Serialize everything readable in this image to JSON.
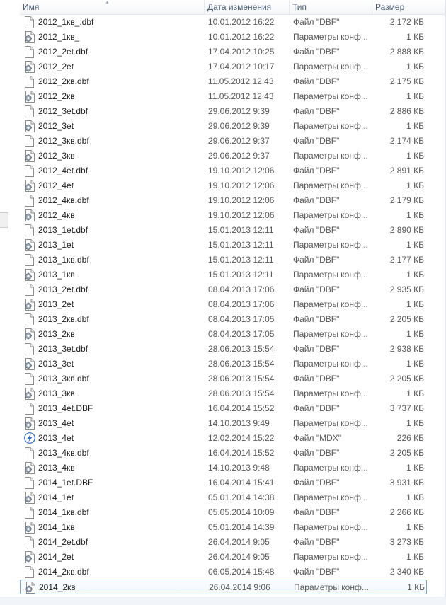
{
  "columns": {
    "name": "Имя",
    "date": "Дата изменения",
    "type": "Тип",
    "size": "Размер"
  },
  "icon_names": {
    "doc": "document-icon",
    "cfg": "settings-file-icon",
    "mdx": "lightning-icon"
  },
  "colors": {
    "selection_border": "#7da2ce",
    "header_text": "#4c607a"
  },
  "files": [
    {
      "name": "2012_1кв_.dbf",
      "date": "10.01.2012 16:22",
      "type": "Файл \"DBF\"",
      "size": "2 172 КБ",
      "icon": "doc"
    },
    {
      "name": "2012_1кв_",
      "date": "10.01.2012 16:22",
      "type": "Параметры конф...",
      "size": "1 КБ",
      "icon": "cfg"
    },
    {
      "name": "2012_2et.dbf",
      "date": "17.04.2012 10:25",
      "type": "Файл \"DBF\"",
      "size": "2 888 КБ",
      "icon": "doc"
    },
    {
      "name": "2012_2et",
      "date": "17.04.2012 10:17",
      "type": "Параметры конф...",
      "size": "1 КБ",
      "icon": "cfg"
    },
    {
      "name": "2012_2кв.dbf",
      "date": "11.05.2012 12:43",
      "type": "Файл \"DBF\"",
      "size": "2 175 КБ",
      "icon": "doc"
    },
    {
      "name": "2012_2кв",
      "date": "11.05.2012 12:43",
      "type": "Параметры конф...",
      "size": "1 КБ",
      "icon": "cfg"
    },
    {
      "name": "2012_3et.dbf",
      "date": "29.06.2012 9:39",
      "type": "Файл \"DBF\"",
      "size": "2 886 КБ",
      "icon": "doc"
    },
    {
      "name": "2012_3et",
      "date": "29.06.2012 9:39",
      "type": "Параметры конф...",
      "size": "1 КБ",
      "icon": "cfg"
    },
    {
      "name": "2012_3кв.dbf",
      "date": "29.06.2012 9:37",
      "type": "Файл \"DBF\"",
      "size": "2 174 КБ",
      "icon": "doc"
    },
    {
      "name": "2012_3кв",
      "date": "29.06.2012 9:37",
      "type": "Параметры конф...",
      "size": "1 КБ",
      "icon": "cfg"
    },
    {
      "name": "2012_4et.dbf",
      "date": "19.10.2012 12:06",
      "type": "Файл \"DBF\"",
      "size": "2 891 КБ",
      "icon": "doc"
    },
    {
      "name": "2012_4et",
      "date": "19.10.2012 12:06",
      "type": "Параметры конф...",
      "size": "1 КБ",
      "icon": "cfg"
    },
    {
      "name": "2012_4кв.dbf",
      "date": "19.10.2012 12:06",
      "type": "Файл \"DBF\"",
      "size": "2 179 КБ",
      "icon": "doc"
    },
    {
      "name": "2012_4кв",
      "date": "19.10.2012 12:06",
      "type": "Параметры конф...",
      "size": "1 КБ",
      "icon": "cfg"
    },
    {
      "name": "2013_1et.dbf",
      "date": "15.01.2013 12:11",
      "type": "Файл \"DBF\"",
      "size": "2 890 КБ",
      "icon": "doc"
    },
    {
      "name": "2013_1et",
      "date": "15.01.2013 12:11",
      "type": "Параметры конф...",
      "size": "1 КБ",
      "icon": "cfg"
    },
    {
      "name": "2013_1кв.dbf",
      "date": "15.01.2013 12:11",
      "type": "Файл \"DBF\"",
      "size": "2 177 КБ",
      "icon": "doc"
    },
    {
      "name": "2013_1кв",
      "date": "15.01.2013 12:11",
      "type": "Параметры конф...",
      "size": "1 КБ",
      "icon": "cfg"
    },
    {
      "name": "2013_2et.dbf",
      "date": "08.04.2013 17:06",
      "type": "Файл \"DBF\"",
      "size": "2 935 КБ",
      "icon": "doc"
    },
    {
      "name": "2013_2et",
      "date": "08.04.2013 17:06",
      "type": "Параметры конф...",
      "size": "1 КБ",
      "icon": "cfg"
    },
    {
      "name": "2013_2кв.dbf",
      "date": "08.04.2013 17:05",
      "type": "Файл \"DBF\"",
      "size": "2 205 КБ",
      "icon": "doc"
    },
    {
      "name": "2013_2кв",
      "date": "08.04.2013 17:05",
      "type": "Параметры конф...",
      "size": "1 КБ",
      "icon": "cfg"
    },
    {
      "name": "2013_3et.dbf",
      "date": "28.06.2013 15:54",
      "type": "Файл \"DBF\"",
      "size": "2 938 КБ",
      "icon": "doc"
    },
    {
      "name": "2013_3et",
      "date": "28.06.2013 15:54",
      "type": "Параметры конф...",
      "size": "1 КБ",
      "icon": "cfg"
    },
    {
      "name": "2013_3кв.dbf",
      "date": "28.06.2013 15:54",
      "type": "Файл \"DBF\"",
      "size": "2 205 КБ",
      "icon": "doc"
    },
    {
      "name": "2013_3кв",
      "date": "28.06.2013 15:54",
      "type": "Параметры конф...",
      "size": "1 КБ",
      "icon": "cfg"
    },
    {
      "name": "2013_4et.DBF",
      "date": "16.04.2014 15:52",
      "type": "Файл \"DBF\"",
      "size": "3 737 КБ",
      "icon": "doc"
    },
    {
      "name": "2013_4et",
      "date": "14.10.2013 9:49",
      "type": "Параметры конф...",
      "size": "1 КБ",
      "icon": "cfg"
    },
    {
      "name": "2013_4et",
      "date": "12.02.2014 15:22",
      "type": "Файл \"MDX\"",
      "size": "226 КБ",
      "icon": "mdx"
    },
    {
      "name": "2013_4кв.dbf",
      "date": "16.04.2014 15:52",
      "type": "Файл \"DBF\"",
      "size": "2 205 КБ",
      "icon": "doc"
    },
    {
      "name": "2013_4кв",
      "date": "14.10.2013 9:48",
      "type": "Параметры конф...",
      "size": "1 КБ",
      "icon": "cfg"
    },
    {
      "name": "2014_1et.DBF",
      "date": "16.04.2014 15:41",
      "type": "Файл \"DBF\"",
      "size": "3 931 КБ",
      "icon": "doc"
    },
    {
      "name": "2014_1et",
      "date": "05.01.2014 14:38",
      "type": "Параметры конф...",
      "size": "1 КБ",
      "icon": "cfg"
    },
    {
      "name": "2014_1кв.dbf",
      "date": "05.05.2014 10:09",
      "type": "Файл \"DBF\"",
      "size": "2 266 КБ",
      "icon": "doc"
    },
    {
      "name": "2014_1кв",
      "date": "05.01.2014 14:39",
      "type": "Параметры конф...",
      "size": "1 КБ",
      "icon": "cfg"
    },
    {
      "name": "2014_2et.dbf",
      "date": "26.04.2014 9:05",
      "type": "Файл \"DBF\"",
      "size": "3 273 КБ",
      "icon": "doc"
    },
    {
      "name": "2014_2et",
      "date": "26.04.2014 9:05",
      "type": "Параметры конф...",
      "size": "1 КБ",
      "icon": "cfg"
    },
    {
      "name": "2014_2кв.dbf",
      "date": "06.05.2014 15:48",
      "type": "Файл \"DBF\"",
      "size": "2 340 КБ",
      "icon": "doc"
    },
    {
      "name": "2014_2кв",
      "date": "26.04.2014 9:06",
      "type": "Параметры конф...",
      "size": "1 КБ",
      "icon": "cfg",
      "selected": true
    }
  ]
}
